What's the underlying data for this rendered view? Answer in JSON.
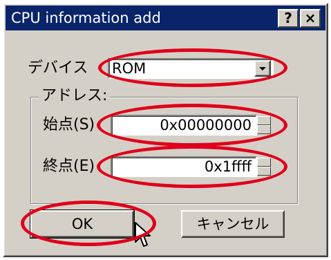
{
  "window": {
    "title": "CPU information add",
    "help_button": "?",
    "close_button": "×"
  },
  "device": {
    "label": "デバイス",
    "value": "ROM"
  },
  "address": {
    "group_label": "アドレス:",
    "start_label": "始点(S)",
    "start_value": "0x00000000",
    "end_label": "終点(E)",
    "end_value": "0x1ffff"
  },
  "buttons": {
    "ok": "OK",
    "cancel": "キャンセル"
  },
  "colors": {
    "titlebar": "#0a246a",
    "dialog_face": "#d4d0c8",
    "annotation_red": "#e0001a"
  },
  "icons": [
    "dropdown-arrow-icon",
    "spin-up-icon",
    "spin-down-icon",
    "mouse-pointer-icon"
  ]
}
